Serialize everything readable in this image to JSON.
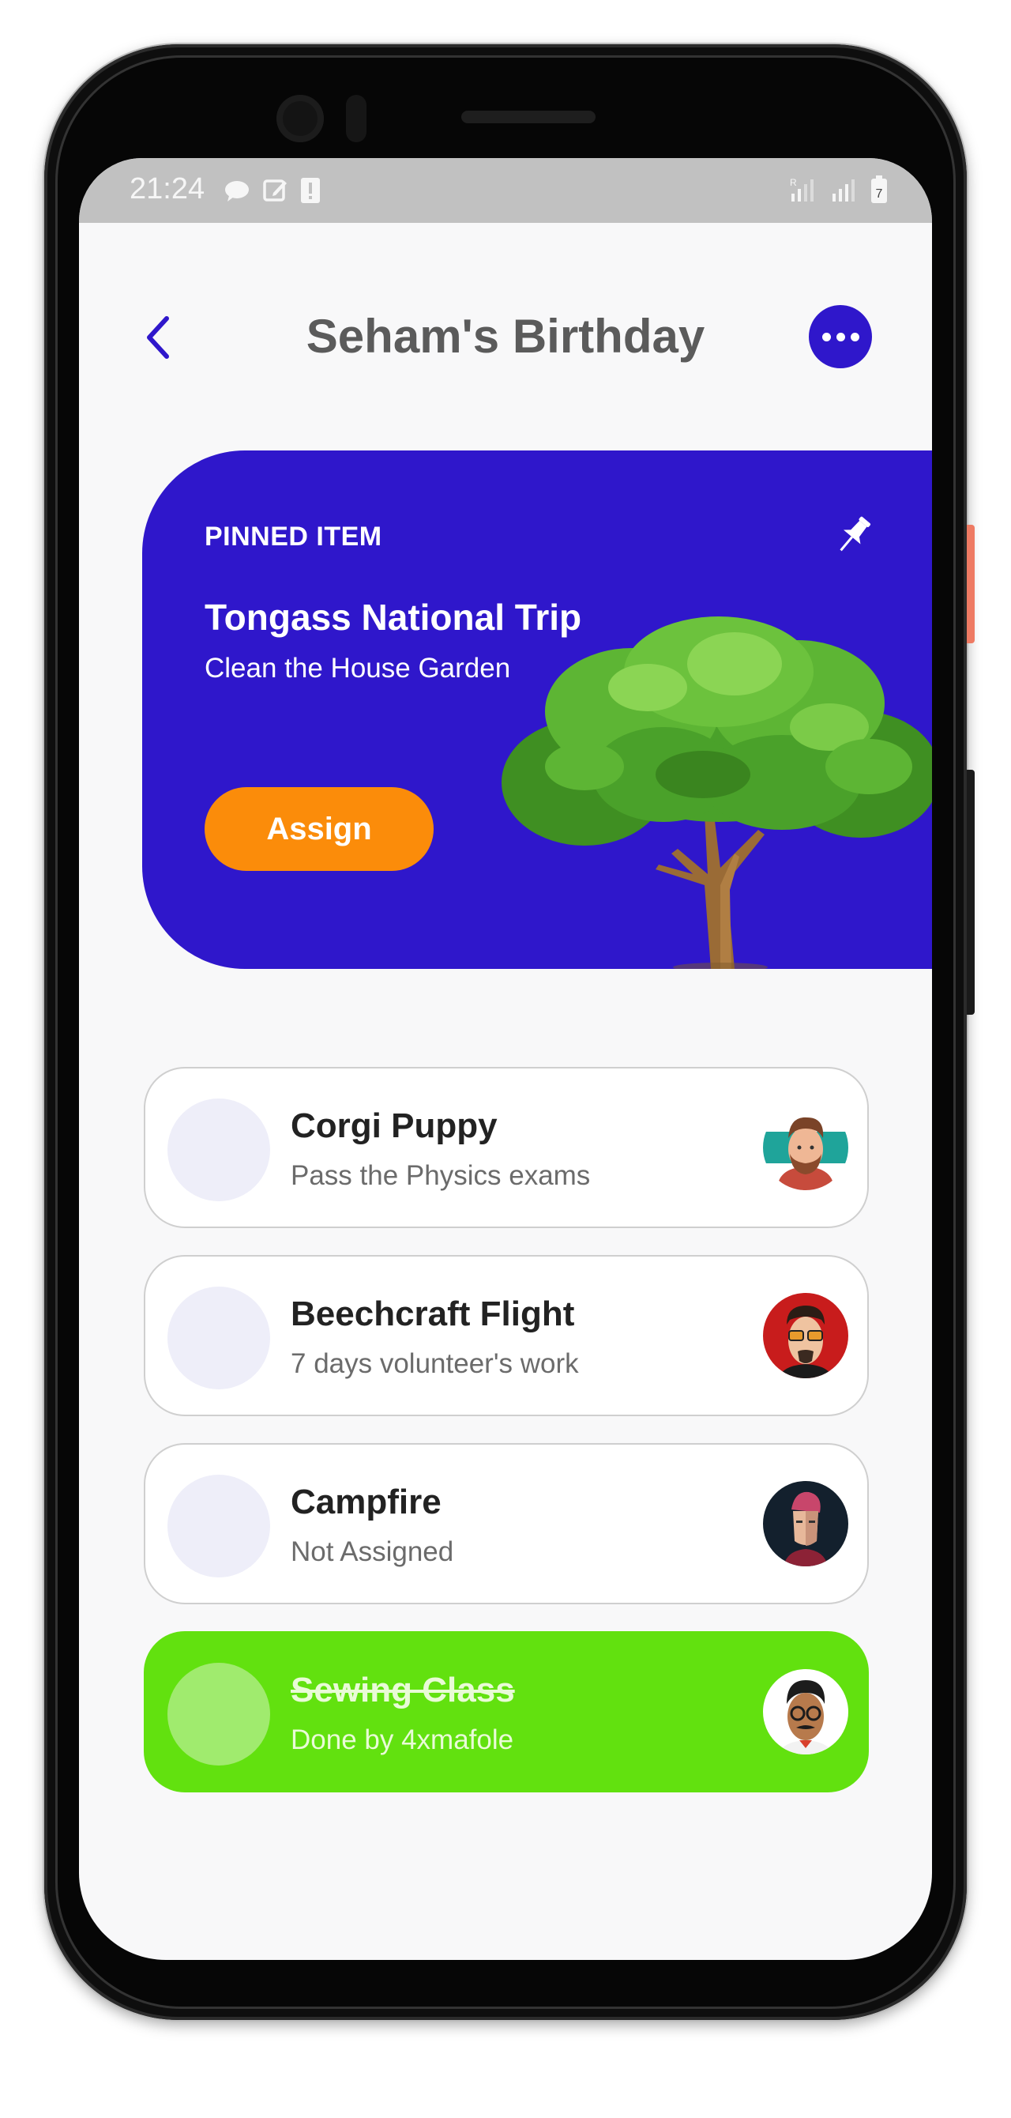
{
  "status_bar": {
    "time": "21:24",
    "left_icons": [
      "message-icon",
      "edit-icon",
      "alert-icon"
    ],
    "right_icons": [
      "signal-r-icon",
      "signal-icon",
      "battery-icon"
    ]
  },
  "header": {
    "title": "Seham's Birthday",
    "back_icon": "chevron-left-icon",
    "more_icon": "more-icon"
  },
  "pinned": {
    "label": "PINNED ITEM",
    "title": "Tongass National Trip",
    "subtitle": "Clean the House Garden",
    "button_label": "Assign",
    "pin_icon": "pin-icon",
    "illustration": "tree-illustration"
  },
  "tasks": [
    {
      "title": "Corgi Puppy",
      "subtitle": "Pass the Physics exams",
      "done": false,
      "avatar": "avatar-bearded-man"
    },
    {
      "title": "Beechcraft Flight",
      "subtitle": "7 days volunteer's work",
      "done": false,
      "avatar": "avatar-sunglasses-man"
    },
    {
      "title": "Campfire",
      "subtitle": "Not Assigned",
      "done": false,
      "avatar": "avatar-pink-hair-man"
    },
    {
      "title": "Sewing Class",
      "subtitle": "Done by 4xmafole",
      "done": true,
      "avatar": "avatar-glasses-man"
    }
  ],
  "colors": {
    "primary": "#2f17cb",
    "accent": "#fb8c0a",
    "done": "#62e10f",
    "title": "#5b5b5b",
    "background": "#f8f8f9"
  }
}
